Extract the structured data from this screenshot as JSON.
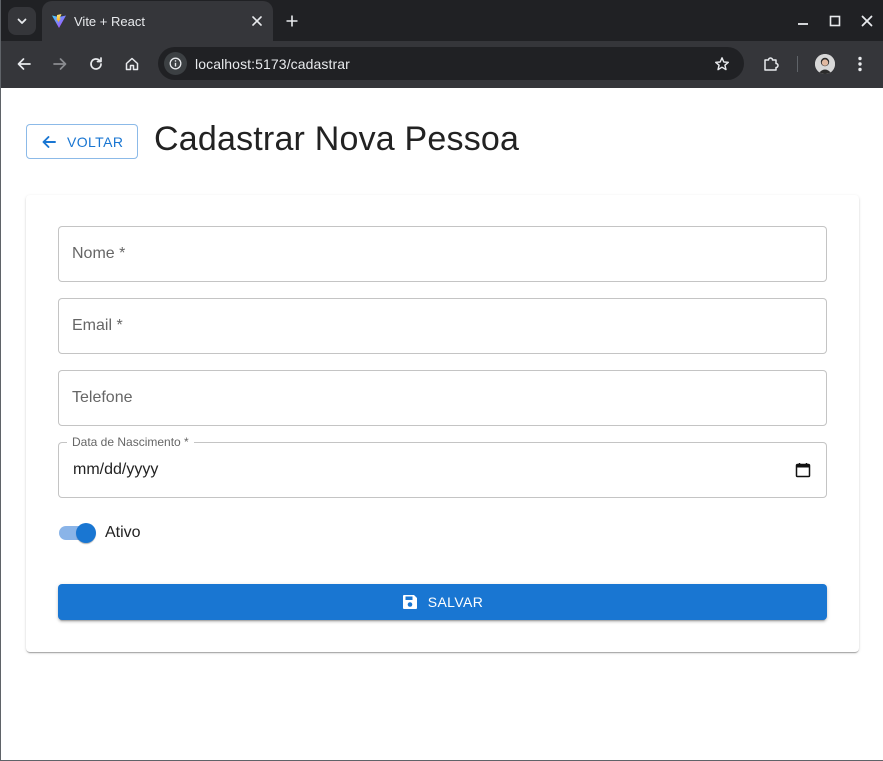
{
  "browser": {
    "tab_title": "Vite + React",
    "url": "localhost:5173/cadastrar"
  },
  "page": {
    "back_label": "VOLTAR",
    "title": "Cadastrar Nova Pessoa"
  },
  "form": {
    "nome_label": "Nome *",
    "email_label": "Email *",
    "telefone_label": "Telefone",
    "nascimento_label": "Data de Nascimento *",
    "nascimento_value": "mm/dd/yyyy",
    "ativo_label": "Ativo",
    "ativo_checked": true,
    "save_label": "SALVAR"
  },
  "colors": {
    "primary": "#1976d2",
    "chrome_dark": "#202124",
    "chrome_toolbar": "#35363a"
  },
  "icons": {
    "tab_menu": "chevron-down-icon",
    "favicon": "vite-logo-icon",
    "close": "close-icon",
    "new_tab": "plus-icon",
    "back": "arrow-left-icon",
    "forward": "arrow-right-icon",
    "reload": "reload-icon",
    "home": "home-icon",
    "site_info": "tune-icon",
    "bookmark": "star-icon",
    "extensions": "puzzle-icon",
    "menu": "kebab-menu-icon",
    "save": "floppy-disk-icon",
    "calendar": "calendar-icon"
  }
}
